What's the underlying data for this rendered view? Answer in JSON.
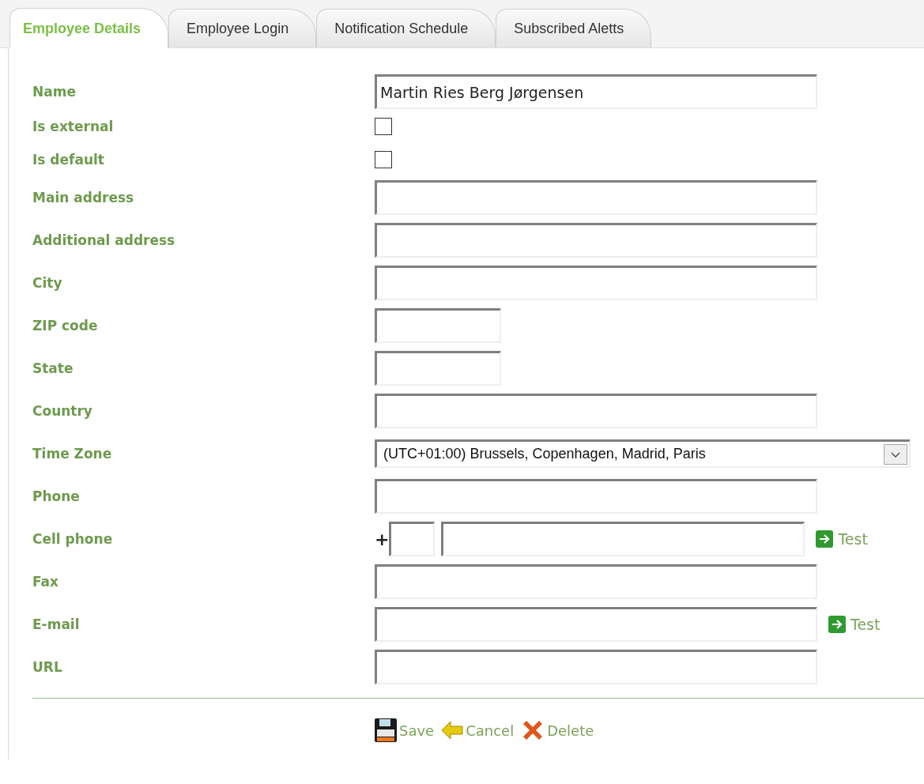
{
  "tabs": [
    {
      "label": "Employee Details",
      "selected": true
    },
    {
      "label": "Employee Login",
      "selected": false
    },
    {
      "label": "Notification Schedule",
      "selected": false
    },
    {
      "label": "Subscribed Aletts",
      "selected": false
    }
  ],
  "fields": [
    {
      "label": "Name",
      "kind": "text",
      "value": "Martin Ries Berg Jørgensen"
    },
    {
      "label": "Is external",
      "kind": "checkbox",
      "checked": false
    },
    {
      "label": "Is default",
      "kind": "checkbox",
      "checked": false
    },
    {
      "label": "Main address",
      "kind": "text"
    },
    {
      "label": "Additional address",
      "kind": "text"
    },
    {
      "label": "City",
      "kind": "text"
    },
    {
      "label": "ZIP code",
      "kind": "short"
    },
    {
      "label": "State",
      "kind": "short"
    },
    {
      "label": "Country",
      "kind": "text"
    },
    {
      "label": "Time Zone",
      "kind": "select",
      "value": "(UTC+01:00) Brussels, Copenhagen, Madrid, Paris"
    },
    {
      "label": "Phone",
      "kind": "text"
    },
    {
      "label": "Cell phone",
      "kind": "phone",
      "prefix": "+",
      "test": "Test"
    },
    {
      "label": "Fax",
      "kind": "text"
    },
    {
      "label": "E-mail",
      "kind": "text",
      "test": "Test"
    },
    {
      "label": "URL",
      "kind": "text"
    }
  ],
  "actions": [
    {
      "label": "Save",
      "kind": "save"
    },
    {
      "label": "Cancel",
      "kind": "cancel"
    },
    {
      "label": "Delete",
      "kind": "delete"
    }
  ]
}
